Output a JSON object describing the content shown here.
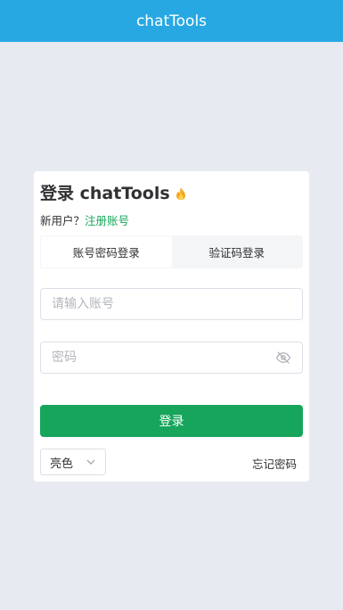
{
  "header": {
    "title": "chatTools"
  },
  "login": {
    "title": "登录 chatTools",
    "signup_prompt": "新用户？",
    "signup_link": "注册账号",
    "tabs": [
      {
        "label": "账号密码登录",
        "active": true
      },
      {
        "label": "验证码登录",
        "active": false
      }
    ],
    "account": {
      "placeholder": "请输入账号",
      "value": ""
    },
    "password": {
      "placeholder": "密码",
      "value": ""
    },
    "submit_label": "登录",
    "theme": {
      "selected": "亮色"
    },
    "forgot_label": "忘记密码"
  },
  "colors": {
    "header_bg": "#28a8e3",
    "accent": "#17a55c",
    "page_bg": "#e7eaf1"
  },
  "icons": [
    "flame-icon",
    "eye-off-icon",
    "chevron-down-icon"
  ]
}
